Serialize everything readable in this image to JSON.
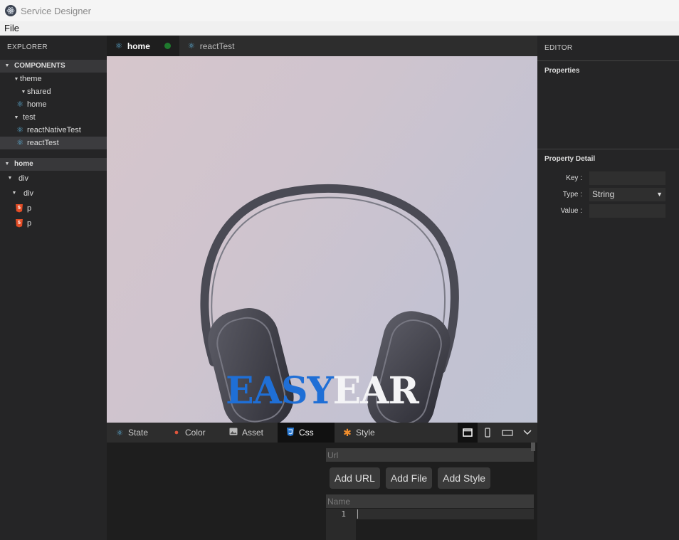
{
  "window": {
    "title": "Service Designer"
  },
  "menu": {
    "file": "File"
  },
  "explorer": {
    "header": "EXPLORER",
    "components_header": "COMPONENTS",
    "components": [
      {
        "label": "theme",
        "type": "folder"
      },
      {
        "label": "shared",
        "type": "folder"
      },
      {
        "label": "home",
        "type": "component"
      },
      {
        "label": "test",
        "type": "folder"
      },
      {
        "label": "reactNativeTest",
        "type": "component"
      },
      {
        "label": "reactTest",
        "type": "component",
        "selected": true
      }
    ],
    "outline_header": "home",
    "outline": [
      {
        "label": "div",
        "type": "element"
      },
      {
        "label": "div",
        "type": "element"
      },
      {
        "label": "p",
        "type": "html"
      },
      {
        "label": "p",
        "type": "html"
      }
    ]
  },
  "tabs": [
    {
      "label": "home",
      "active": true,
      "dirty": true
    },
    {
      "label": "reactTest",
      "active": false
    }
  ],
  "canvas": {
    "logo_part1": "EASY",
    "logo_part2": "EAR",
    "logo_color_1": "#1f6fd6",
    "logo_color_2": "#f4f4f6",
    "image": "headphones"
  },
  "bottom_tabs": [
    {
      "label": "State",
      "icon": "react-icon"
    },
    {
      "label": "Color",
      "icon": "palette-icon"
    },
    {
      "label": "Asset",
      "icon": "image-icon"
    },
    {
      "label": "Css",
      "icon": "css3-icon",
      "active": true
    },
    {
      "label": "Style",
      "icon": "asterisk-icon"
    }
  ],
  "view_buttons": [
    "desktop-view-icon",
    "mobile-view-icon",
    "tablet-view-icon",
    "chevron-down-icon"
  ],
  "css_panel": {
    "url_placeholder": "Url",
    "add_url": "Add URL",
    "add_file": "Add File",
    "add_style": "Add Style",
    "name_placeholder": "Name",
    "line_number": "1"
  },
  "editor": {
    "header": "EDITOR",
    "properties_title": "Properties",
    "detail_title": "Property Detail",
    "key_label": "Key :",
    "type_label": "Type :",
    "type_value": "String",
    "value_label": "Value :"
  }
}
